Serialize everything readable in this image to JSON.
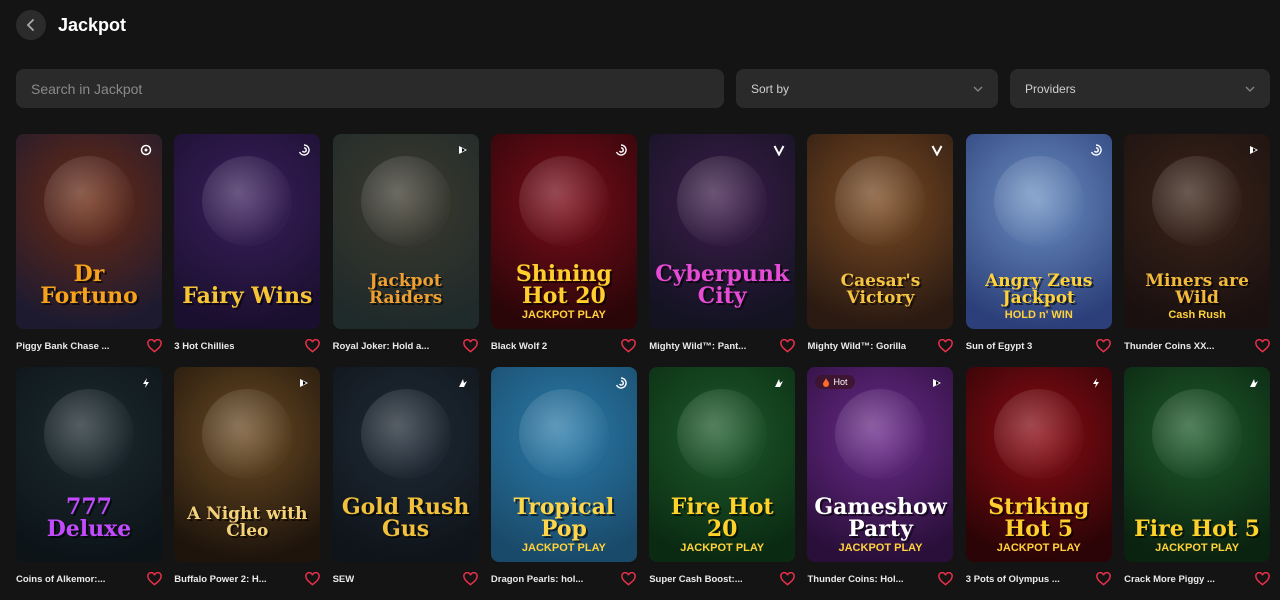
{
  "page": {
    "title": "Jackpot"
  },
  "search": {
    "placeholder": "Search in Jackpot",
    "value": ""
  },
  "filters": {
    "sort_label": "Sort by",
    "providers_label": "Providers"
  },
  "games": [
    {
      "name": "Piggy Bank Chase ...",
      "art": "Dr Fortuno",
      "sub": "",
      "badge": "pin-icon",
      "bg": "#6b2a12",
      "bg2": "#1d1a30",
      "color": "#f6a21a"
    },
    {
      "name": "3 Hot Chillies",
      "art": "Fairy Wins",
      "sub": "",
      "badge": "swirl-icon",
      "bg": "#3a1f5c",
      "bg2": "#1a0f2e",
      "color": "#f7c435"
    },
    {
      "name": "Royal Joker: Hold a...",
      "art": "Jackpot Raiders",
      "sub": "",
      "badge": "play-icon",
      "bg": "#3d3a2e",
      "bg2": "#1f2a2a",
      "color": "#f0a030"
    },
    {
      "name": "Black Wolf 2",
      "art": "Shining Hot 20",
      "sub": "JACKPOT PLAY",
      "badge": "swirl-icon",
      "bg": "#7a0c1a",
      "bg2": "#2a0608",
      "color": "#ffcf2e"
    },
    {
      "name": "Mighty Wild™: Pant...",
      "art": "Cyberpunk City",
      "sub": "",
      "badge": "v-icon",
      "bg": "#3c1c4a",
      "bg2": "#131322",
      "color": "#e84bd6"
    },
    {
      "name": "Mighty Wild™: Gorilla",
      "art": "Caesar's Victory",
      "sub": "",
      "badge": "v-icon",
      "bg": "#7a4a22",
      "bg2": "#2a1a12",
      "color": "#f5c542"
    },
    {
      "name": "Sun of Egypt 3",
      "art": "Angry Zeus Jackpot",
      "sub": "HOLD n' WIN",
      "badge": "swirl-icon",
      "bg": "#6a8ec0",
      "bg2": "#2c3f7a",
      "color": "#ffd23a"
    },
    {
      "name": "Thunder Coins XX...",
      "art": "Miners are Wild",
      "sub": "Cash Rush",
      "badge": "play-icon",
      "bg": "#3a2418",
      "bg2": "#1a1010",
      "color": "#f2b93a"
    },
    {
      "name": "Coins of Alkemor:...",
      "art": "777 Deluxe",
      "sub": "",
      "badge": "bolt-icon",
      "bg": "#1c2a30",
      "bg2": "#0c1418",
      "color": "#c24bff"
    },
    {
      "name": "Buffalo Power 2: H...",
      "art": "A Night with Cleo",
      "sub": "",
      "badge": "play-icon",
      "bg": "#6a4a22",
      "bg2": "#1e140c",
      "color": "#f4d27a"
    },
    {
      "name": "SEW",
      "art": "Gold Rush Gus",
      "sub": "",
      "badge": "bird-icon",
      "bg": "#1f2a36",
      "bg2": "#0f141a",
      "color": "#f2c03a"
    },
    {
      "name": "Dragon Pearls: hol...",
      "art": "Tropical Pop",
      "sub": "JACKPOT PLAY",
      "badge": "swirl-icon",
      "bg": "#2a7aa8",
      "bg2": "#1a4a6a",
      "color": "#ffd64a"
    },
    {
      "name": "Super Cash Boost:...",
      "art": "Fire Hot 20",
      "sub": "JACKPOT PLAY",
      "badge": "bird-icon",
      "bg": "#1d5a2a",
      "bg2": "#0a2a12",
      "color": "#ffd22a"
    },
    {
      "name": "Thunder Coins: Hol...",
      "art": "Gameshow Party",
      "sub": "JACKPOT PLAY",
      "badge": "play-icon",
      "bg": "#6a2a8a",
      "bg2": "#2a0f3a",
      "color": "#ffffff",
      "hot": "Hot"
    },
    {
      "name": "3 Pots of Olympus ...",
      "art": "Striking Hot 5",
      "sub": "JACKPOT PLAY",
      "badge": "bolt-icon",
      "bg": "#8a0c14",
      "bg2": "#2a0406",
      "color": "#ffcf2e"
    },
    {
      "name": "Crack More Piggy ...",
      "art": "Fire Hot 5",
      "sub": "JACKPOT PLAY",
      "badge": "bird-icon",
      "bg": "#1d5a2a",
      "bg2": "#0a2210",
      "color": "#ffd22a"
    }
  ]
}
